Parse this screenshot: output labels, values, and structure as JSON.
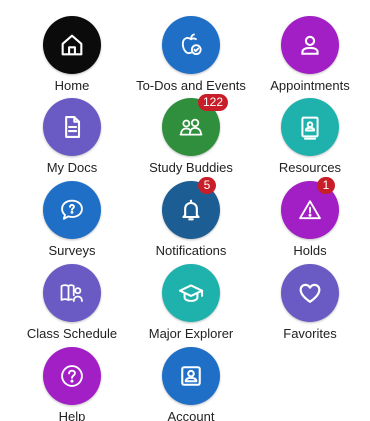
{
  "colors": {
    "black": "#0b0b0b",
    "blue": "#1f6fc6",
    "purple": "#a11fc4",
    "indigo": "#6a5bc4",
    "green": "#2f8f3d",
    "teal": "#1fb2ac",
    "dark_teal": "#1c5d93",
    "violet": "#7a2fc0",
    "badge": "#c81e2a"
  },
  "tiles": [
    {
      "label": "Home",
      "icon": "home-icon"
    },
    {
      "label": "To-Dos and Events",
      "icon": "apple-check-icon"
    },
    {
      "label": "Appointments",
      "icon": "person-icon"
    },
    {
      "label": "My Docs",
      "icon": "document-icon"
    },
    {
      "label": "Study Buddies",
      "icon": "study-buddies-icon",
      "badge": "122"
    },
    {
      "label": "Resources",
      "icon": "resources-icon"
    },
    {
      "label": "Surveys",
      "icon": "speech-bubble-icon"
    },
    {
      "label": "Notifications",
      "icon": "bell-icon",
      "badge": "5"
    },
    {
      "label": "Holds",
      "icon": "warning-triangle-icon",
      "badge": "1"
    },
    {
      "label": "Class Schedule",
      "icon": "book-person-icon"
    },
    {
      "label": "Major Explorer",
      "icon": "graduation-cap-icon"
    },
    {
      "label": "Favorites",
      "icon": "heart-icon"
    },
    {
      "label": "Help",
      "icon": "help-icon"
    },
    {
      "label": "Account",
      "icon": "account-icon"
    }
  ]
}
